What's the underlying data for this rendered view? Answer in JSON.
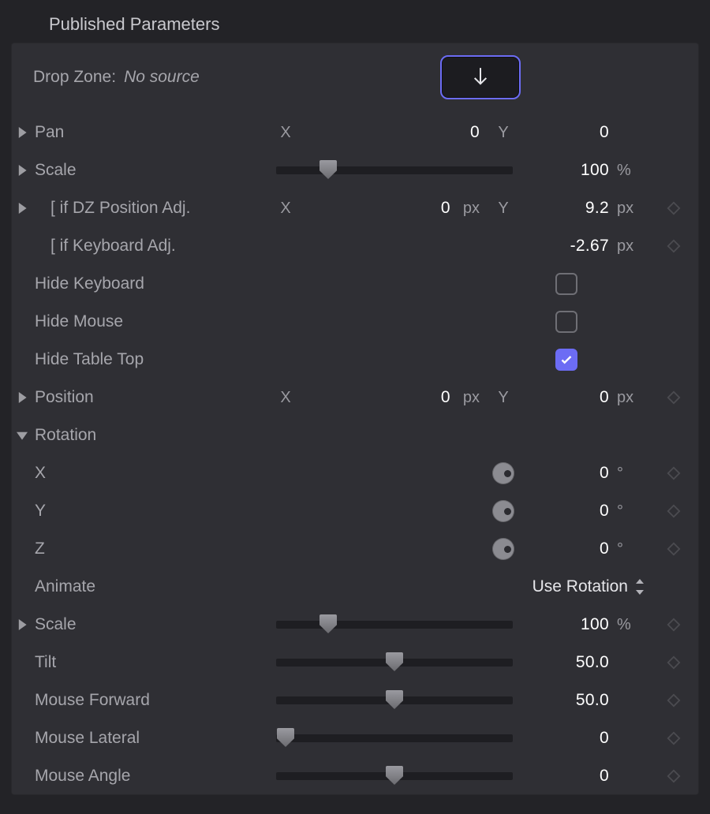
{
  "section_title": "Published Parameters",
  "drop_zone": {
    "label": "Drop Zone:",
    "source": "No source"
  },
  "rows": {
    "pan": {
      "label": "Pan",
      "x": "0",
      "y": "0"
    },
    "scale": {
      "label": "Scale",
      "value": "100",
      "unit": "%",
      "slider": 22
    },
    "dz_pos_adj": {
      "label": "[ if DZ Position Adj.",
      "x": "0",
      "x_unit": "px",
      "y": "9.2",
      "y_unit": "px"
    },
    "kb_adj": {
      "label": "[ if Keyboard Adj.",
      "value": "-2.67",
      "unit": "px"
    },
    "hide_keyboard": {
      "label": "Hide Keyboard",
      "checked": false
    },
    "hide_mouse": {
      "label": "Hide Mouse",
      "checked": false
    },
    "hide_tabletop": {
      "label": "Hide Table Top",
      "checked": true
    },
    "position": {
      "label": "Position",
      "x": "0",
      "x_unit": "px",
      "y": "0",
      "y_unit": "px"
    },
    "rotation": {
      "label": "Rotation"
    },
    "rot_x": {
      "label": "X",
      "value": "0",
      "unit": "°"
    },
    "rot_y": {
      "label": "Y",
      "value": "0",
      "unit": "°"
    },
    "rot_z": {
      "label": "Z",
      "value": "0",
      "unit": "°"
    },
    "animate": {
      "label": "Animate",
      "value": "Use Rotation"
    },
    "scale2": {
      "label": "Scale",
      "value": "100",
      "unit": "%",
      "slider": 22
    },
    "tilt": {
      "label": "Tilt",
      "value": "50.0",
      "slider": 50
    },
    "mouse_fwd": {
      "label": "Mouse Forward",
      "value": "50.0",
      "slider": 50
    },
    "mouse_lat": {
      "label": "Mouse Lateral",
      "value": "0",
      "slider": 4
    },
    "mouse_ang": {
      "label": "Mouse Angle",
      "value": "0",
      "slider": 50
    }
  }
}
